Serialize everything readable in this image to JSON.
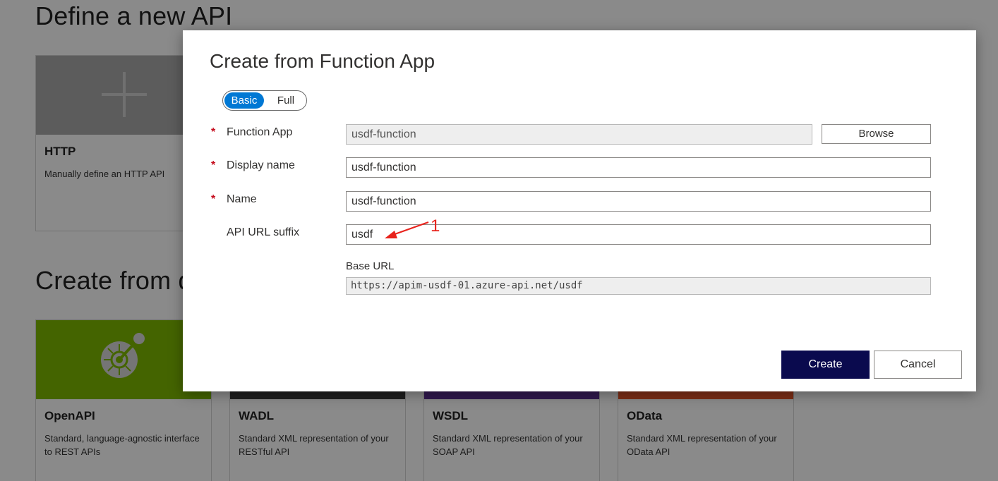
{
  "background": {
    "section1_title": "Define a new API",
    "section2_title": "Create from definition",
    "http_tile": {
      "name": "HTTP",
      "desc": "Manually define an HTTP API"
    },
    "tiles": [
      {
        "name": "OpenAPI",
        "desc": "Standard, language-agnostic interface to REST APIs",
        "color": "#7fba00"
      },
      {
        "name": "WADL",
        "desc": "Standard XML representation of your RESTful API",
        "color": "#3a3a3a"
      },
      {
        "name": "WSDL",
        "desc": "Standard XML representation of your SOAP API",
        "color": "#5c2d91"
      },
      {
        "name": "OData",
        "desc": "Standard XML representation of your OData API",
        "color": "#e8562a"
      }
    ]
  },
  "dialog": {
    "title": "Create from Function App",
    "mode": {
      "basic": "Basic",
      "full": "Full",
      "selected": "Basic"
    },
    "fields": {
      "function_app": {
        "label": "Function App",
        "value": "usdf-function",
        "required": "*"
      },
      "display_name": {
        "label": "Display name",
        "value": "usdf-function",
        "required": "*"
      },
      "name": {
        "label": "Name",
        "value": "usdf-function",
        "required": "*"
      },
      "api_url_suffix": {
        "label": "API URL suffix",
        "value": "usdf"
      }
    },
    "browse_label": "Browse",
    "base_url_label": "Base URL",
    "base_url_value": "https://apim-usdf-01.azure-api.net/usdf",
    "create_label": "Create",
    "cancel_label": "Cancel"
  },
  "annotation": {
    "number": "1",
    "color": "#e8231c"
  },
  "colors": {
    "accent": "#0078d4",
    "primary_button": "#0a0a4e",
    "required": "#c50f1f"
  }
}
